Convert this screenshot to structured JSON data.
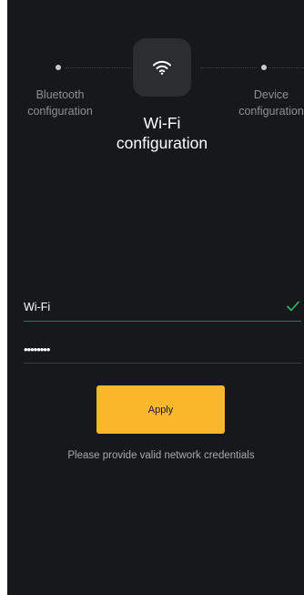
{
  "stepper": {
    "previous_step_label": "Bluetooth\nconfiguration",
    "current_step_label": "Wi-Fi\nconfiguration",
    "next_step_label": "Device\nconfiguration",
    "current_step_icon": "wifi-icon"
  },
  "form": {
    "ssid_value": "Wi-Fi",
    "ssid_valid_icon": "check-icon",
    "password_value": "••••••••"
  },
  "actions": {
    "apply_label": "Apply"
  },
  "messages": {
    "hint": "Please provide valid network credentials"
  },
  "colors": {
    "background": "#17181b",
    "accent": "#fbb72c",
    "valid": "#2fbf5a",
    "muted_text": "#8e9096"
  }
}
